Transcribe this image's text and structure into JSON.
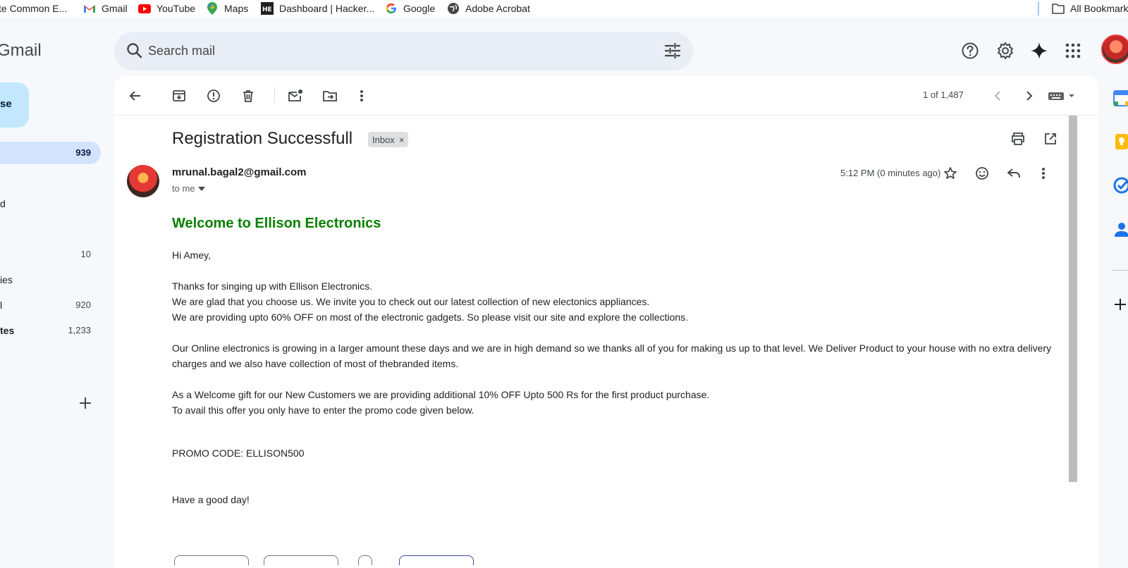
{
  "bookmarks": [
    {
      "label": "te Common E...",
      "icon": "bookmark-page-icon"
    },
    {
      "label": "Gmail",
      "icon": "gmail-icon"
    },
    {
      "label": "YouTube",
      "icon": "youtube-icon"
    },
    {
      "label": "Maps",
      "icon": "maps-icon"
    },
    {
      "label": "Dashboard | Hacker...",
      "icon": "hackerearth-icon"
    },
    {
      "label": "Google",
      "icon": "google-icon"
    },
    {
      "label": "Adobe Acrobat",
      "icon": "globe-icon"
    }
  ],
  "all_bookmarks": "All Bookmarks",
  "app": {
    "logo_text": "Gmail"
  },
  "search": {
    "placeholder": "Search mail"
  },
  "compose": {
    "label": "se"
  },
  "nav": [
    {
      "label": "",
      "count": "939"
    },
    {
      "label": "d",
      "count": ""
    },
    {
      "label": "",
      "count": "10"
    },
    {
      "label": "ies",
      "count": ""
    },
    {
      "label": "l",
      "count": "920"
    },
    {
      "label": "tes",
      "count": "1,233"
    }
  ],
  "toolbar": {
    "pager": "1 of 1,487"
  },
  "email": {
    "subject": "Registration Successfull",
    "label_chip": "Inbox",
    "chip_close": "×",
    "sender": "mrunal.bagal2@gmail.com",
    "to": "to me",
    "timestamp": "5:12 PM (0 minutes ago)",
    "heading": "Welcome to Ellison Electronics",
    "greeting": "Hi Amey,",
    "para1": [
      "Thanks for singing up with Ellison Electronics.",
      "We are glad that you choose us. We invite you to check out our latest collection of new electonics appliances.",
      "We are providing upto 60% OFF on most of the electronic gadgets. So please visit our site and explore the collections."
    ],
    "para2": "Our Online electronics is growing in a larger amount these days and we are in high demand so we thanks all of you for making us up to that level. We Deliver Product to your house with no extra delivery charges and we also have collection of most of thebranded items.",
    "para3": [
      "As a Welcome gift for our New Customers we are providing additional 10% OFF Upto 500 Rs for the first product purchase.",
      "To avail this offer you only have to enter the promo code given below."
    ],
    "promo": "PROMO CODE: ELLISON500",
    "closing": "Have a good day!"
  },
  "colors": {
    "accent_green": "#0a8000",
    "compose_bg": "#c2e7ff",
    "active_nav_bg": "#d3e3fd"
  },
  "side_panel_icons": [
    "calendar-icon",
    "keep-icon",
    "tasks-icon",
    "contacts-icon",
    "add-icon"
  ]
}
